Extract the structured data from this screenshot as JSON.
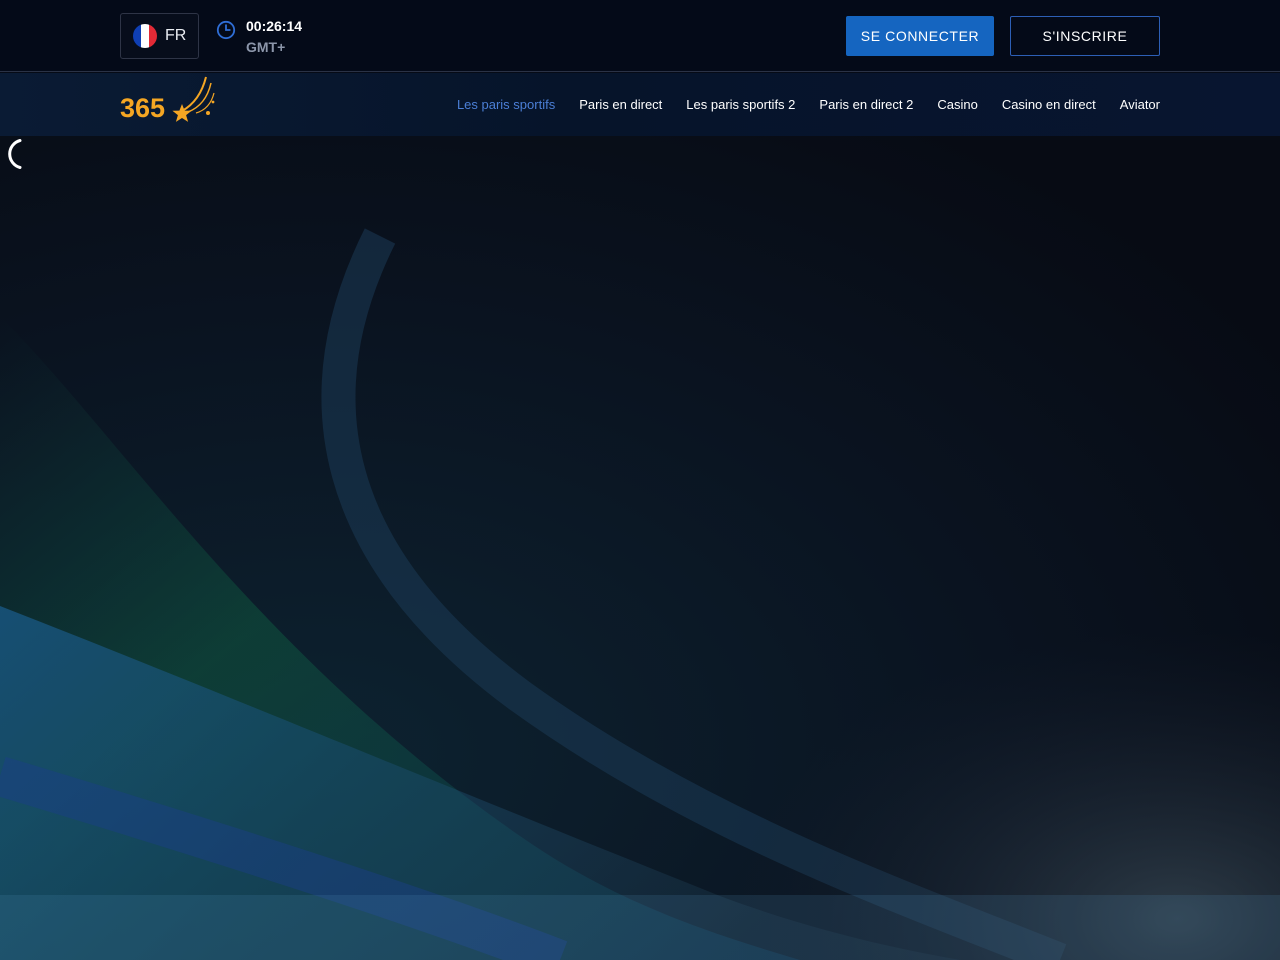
{
  "header": {
    "language": {
      "code": "FR",
      "flag_colors": [
        "#0f3fb4",
        "#ffffff",
        "#e22a36"
      ]
    },
    "clock": {
      "time": "00:26:14",
      "timezone": "GMT+",
      "icon": "clock-icon"
    },
    "login_label": "SE CONNECTER",
    "register_label": "S'INSCRIRE"
  },
  "logo": {
    "text": "365",
    "icon": "shooting-star-logo",
    "color": "#f5a623"
  },
  "nav": {
    "items": [
      {
        "label": "Les paris sportifs",
        "active": true
      },
      {
        "label": "Paris en direct",
        "active": false
      },
      {
        "label": "Les paris sportifs 2",
        "active": false
      },
      {
        "label": "Paris en direct 2",
        "active": false
      },
      {
        "label": "Casino",
        "active": false
      },
      {
        "label": "Casino en direct",
        "active": false
      },
      {
        "label": "Aviator",
        "active": false
      }
    ]
  },
  "hero": {
    "state": "loading",
    "icon": "loading-spinner-icon"
  },
  "colors": {
    "primary_button": "#1565c0",
    "active_nav": "#4b7fd6",
    "accent": "#f5a623",
    "background": "#060b16"
  }
}
